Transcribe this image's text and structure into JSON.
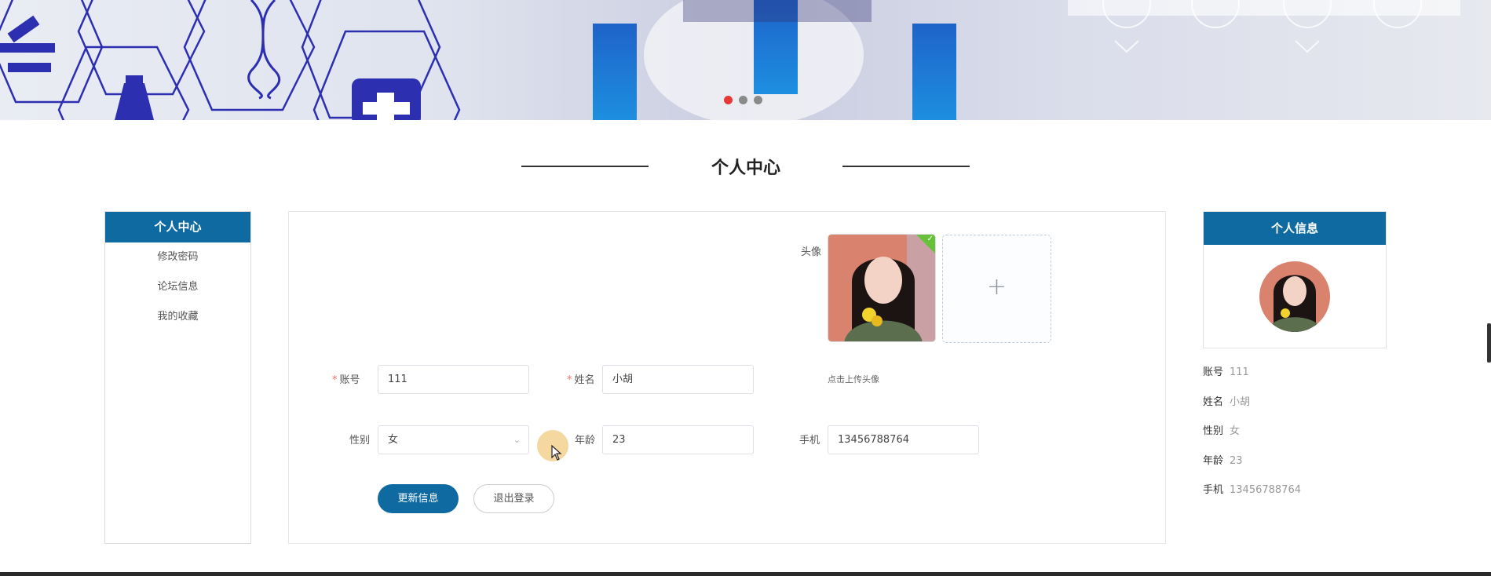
{
  "banner": {
    "slides": 3,
    "active_slide": 1
  },
  "page_title": "个人中心",
  "left_menu": {
    "header": "个人中心",
    "items": [
      "修改密码",
      "论坛信息",
      "我的收藏"
    ]
  },
  "form": {
    "avatar_label": "头像",
    "upload_hint": "点击上传头像",
    "account_label": "账号",
    "account_value": "111",
    "name_label": "姓名",
    "name_value": "小胡",
    "gender_label": "性别",
    "gender_value": "女",
    "age_label": "年龄",
    "age_value": "23",
    "phone_label": "手机",
    "phone_value": "13456788764",
    "update_button": "更新信息",
    "logout_button": "退出登录"
  },
  "profile": {
    "header": "个人信息",
    "rows": [
      {
        "k": "账号",
        "v": "111"
      },
      {
        "k": "姓名",
        "v": "小胡"
      },
      {
        "k": "性别",
        "v": "女"
      },
      {
        "k": "年龄",
        "v": "23"
      },
      {
        "k": "手机",
        "v": "13456788764"
      }
    ]
  },
  "colors": {
    "primary": "#0e6aa1",
    "active_dot": "#e53935",
    "required": "#f56c6c",
    "upload_ok": "#67c23a"
  }
}
